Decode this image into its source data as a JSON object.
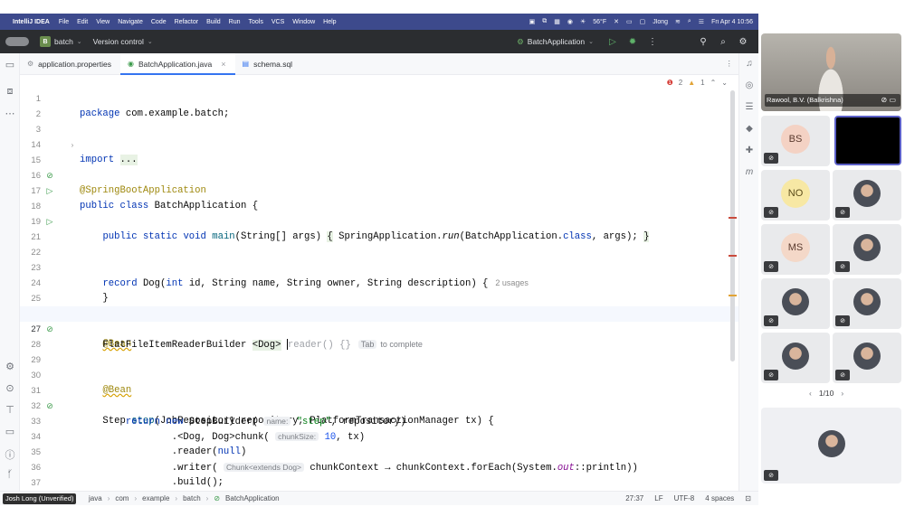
{
  "menubar": {
    "apple": "",
    "app_name": "IntelliJ IDEA",
    "menus": [
      "File",
      "Edit",
      "View",
      "Navigate",
      "Code",
      "Refactor",
      "Build",
      "Run",
      "Tools",
      "VCS",
      "Window",
      "Help"
    ],
    "weather": "56°F",
    "user": "Jlong",
    "datetime": "Fri Apr 4  10:56"
  },
  "toolbar": {
    "project_badge": "B",
    "project": "batch",
    "vcs": "Version control",
    "run_config": "BatchApplication"
  },
  "tabs": [
    {
      "label": "application.properties",
      "active": false
    },
    {
      "label": "BatchApplication.java",
      "active": true
    },
    {
      "label": "schema.sql",
      "active": false
    }
  ],
  "editor": {
    "errors": "2",
    "warnings": "1",
    "lines": {
      "l1": {
        "n": "1"
      },
      "l2": {
        "n": "2"
      },
      "l3": {
        "n": "3",
        "text": "import ..."
      },
      "l14": {
        "n": "14"
      },
      "l15": {
        "n": "15"
      },
      "l16": {
        "n": "16"
      },
      "l17": {
        "n": "17"
      },
      "l18": {
        "n": "18"
      },
      "l19": {
        "n": "19"
      },
      "l21": {
        "n": "21"
      },
      "l22": {
        "n": "22"
      },
      "l23": {
        "n": "23",
        "usages": "2 usages"
      },
      "l24": {
        "n": "24"
      },
      "l25": {
        "n": "25"
      },
      "l26": {
        "n": "26"
      },
      "l27": {
        "n": "27",
        "tab_key": "Tab",
        "tab_hint": "to complete"
      },
      "l28": {
        "n": "28"
      },
      "l29": {
        "n": "29"
      },
      "l30": {
        "n": "30"
      },
      "l31": {
        "n": "31"
      },
      "l32": {
        "n": "32",
        "hint": "name:"
      },
      "l33": {
        "n": "33",
        "hint": "chunkSize:"
      },
      "l34": {
        "n": "34"
      },
      "l35": {
        "n": "35",
        "hint": "Chunk<extends Dog>"
      },
      "l36": {
        "n": "36"
      },
      "l37": {
        "n": "37"
      },
      "l38": {
        "n": "38"
      },
      "l39": {
        "n": "39"
      }
    }
  },
  "statusbar": {
    "breadcrumbs": [
      "java",
      "com",
      "example",
      "batch",
      "BatchApplication"
    ],
    "position": "27:37",
    "line_sep": "LF",
    "encoding": "UTF-8",
    "indent": "4 spaces"
  },
  "meeting": {
    "owner_label": "Josh Long (Unverified)",
    "speaker_name": "Rawool, B.V. (Balkrishna)",
    "participants": [
      "BS",
      "NO",
      "MS"
    ],
    "pager": "1/10"
  },
  "colors": {
    "menubar": "#3d4a8c",
    "toolbar": "#2b2d30",
    "keyword": "#0033b3",
    "annotation": "#9e880d",
    "accent": "#3574f0"
  }
}
